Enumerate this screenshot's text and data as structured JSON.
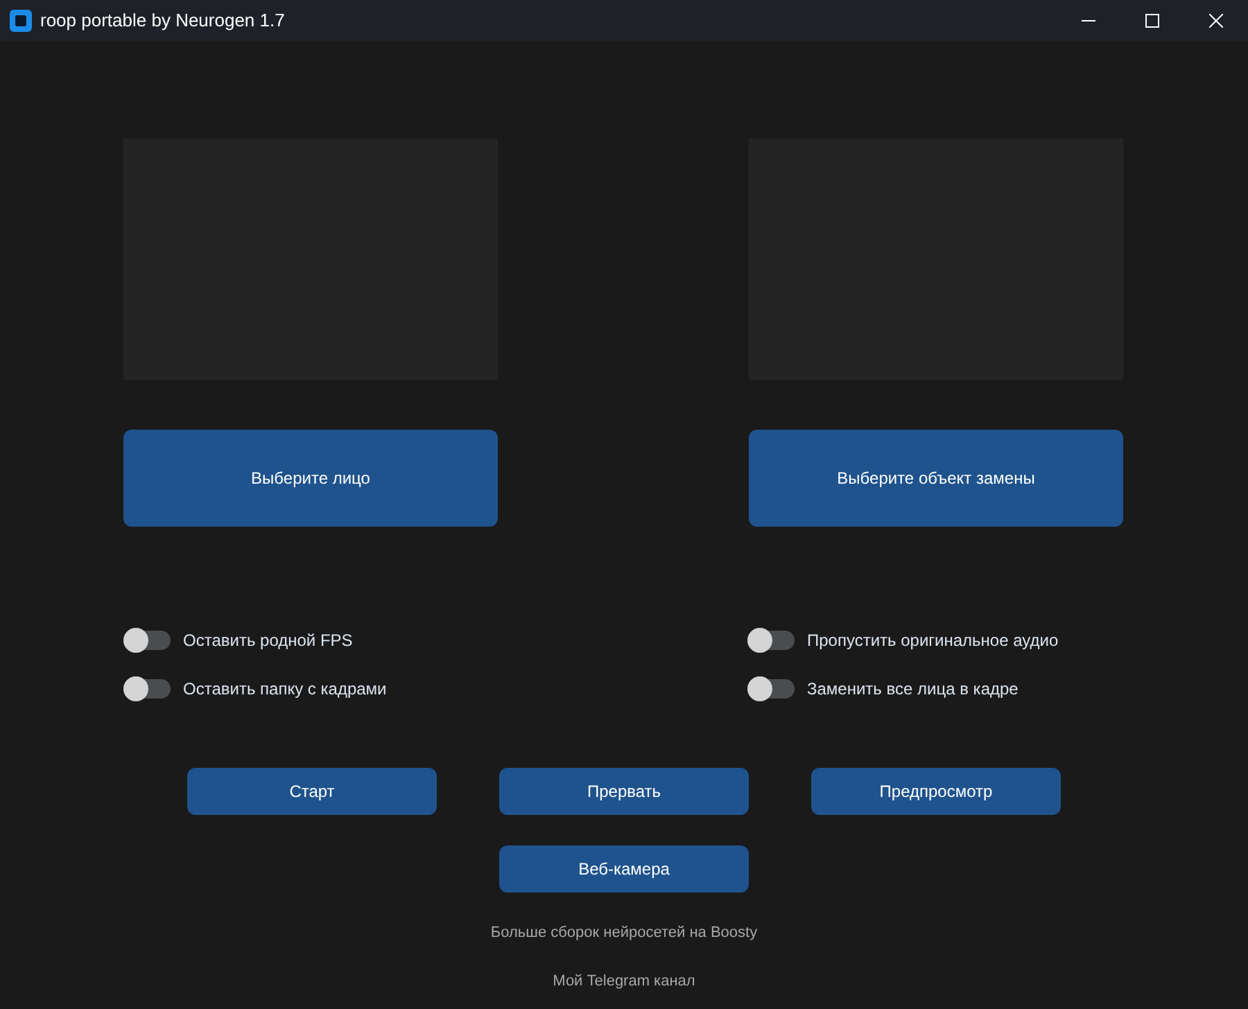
{
  "window": {
    "title": "roop portable by Neurogen 1.7"
  },
  "panels": [
    {
      "button": "Выберите лицо"
    },
    {
      "button": "Выберите объект замены"
    }
  ],
  "switches": [
    {
      "label": "Оставить родной FPS",
      "checked": false
    },
    {
      "label": "Пропустить оригинальное аудио",
      "checked": false
    },
    {
      "label": "Оставить папку с кадрами",
      "checked": false
    },
    {
      "label": "Заменить все лица в кадре",
      "checked": false
    }
  ],
  "buttons": [
    "Старт",
    "Прервать",
    "Предпросмотр"
  ],
  "webcam_button": "Веб-камера",
  "links": [
    "Больше сборок нейросетей на Boosty",
    "Мой Telegram канал"
  ]
}
